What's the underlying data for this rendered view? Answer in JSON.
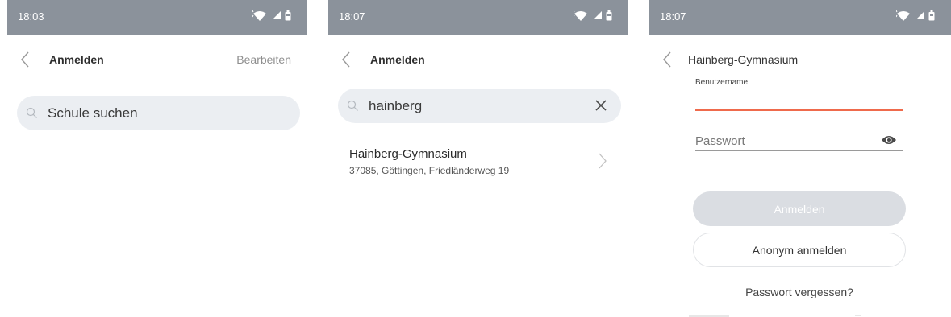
{
  "screens": [
    {
      "status": {
        "time": "18:03"
      },
      "nav": {
        "title": "Anmelden",
        "action": "Bearbeiten"
      },
      "search": {
        "value": "",
        "placeholder": "Schule suchen"
      }
    },
    {
      "status": {
        "time": "18:07"
      },
      "nav": {
        "title": "Anmelden"
      },
      "search": {
        "value": "hainberg"
      },
      "results": [
        {
          "title": "Hainberg-Gymnasium",
          "subtitle": "37085, Göttingen, Friedländerweg 19"
        }
      ]
    },
    {
      "status": {
        "time": "18:07"
      },
      "nav": {
        "title": "Hainberg-Gymnasium"
      },
      "form": {
        "username_label": "Benutzername",
        "username_value": "",
        "password_placeholder": "Passwort",
        "login_button": "Anmelden",
        "anonymous_button": "Anonym anmelden",
        "forgot_link": "Passwort vergessen?"
      }
    }
  ],
  "icons": {
    "status": [
      "wifi-icon",
      "signal-icon",
      "battery-icon"
    ],
    "nav": "chevron-left-icon",
    "search": "search-icon",
    "clear": "close-icon",
    "row": "chevron-right-icon",
    "password_toggle": "eye-icon"
  },
  "colors": {
    "status_bar": "#8b929b",
    "search_background": "#ebeef2",
    "focus_underline": "#ef6a4c",
    "disabled_button": "#dadde2"
  }
}
